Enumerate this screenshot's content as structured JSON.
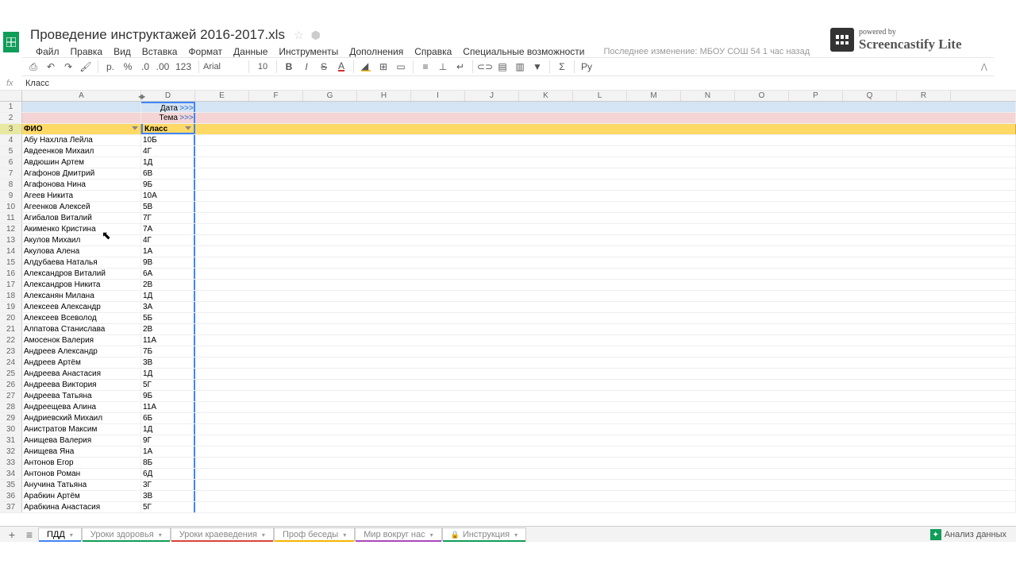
{
  "title": "Проведение инструктажей 2016-2017.xls",
  "menus": [
    "Файл",
    "Правка",
    "Вид",
    "Вставка",
    "Формат",
    "Данные",
    "Инструменты",
    "Дополнения",
    "Справка",
    "Специальные возможности"
  ],
  "last_edit": "Последнее изменение: МБОУ СОШ 54 1 час назад",
  "toolbar": {
    "font": "Arial",
    "size": "10",
    "ruble": "р.",
    "pct": "%",
    "dec0": "0←",
    "dec00": ".00",
    "fmt123": "123"
  },
  "fx_value": "Класс",
  "col_letters": [
    "A",
    "D",
    "E",
    "F",
    "G",
    "H",
    "I",
    "J",
    "K",
    "L",
    "M",
    "N",
    "O",
    "P",
    "Q",
    "R"
  ],
  "row1": {
    "label": "Дата",
    "arrow": ">>>"
  },
  "row2": {
    "label": "Тема",
    "arrow": ">>>"
  },
  "row3": {
    "fio": "ФИО",
    "klass": "Класс"
  },
  "data_rows": [
    {
      "n": 4,
      "a": "Абу Нахлла Лейла",
      "d": "10Б"
    },
    {
      "n": 5,
      "a": "Авдеенков Михаил",
      "d": "4Г"
    },
    {
      "n": 6,
      "a": "Авдюшин Артем",
      "d": "1Д"
    },
    {
      "n": 7,
      "a": "Агафонов Дмитрий",
      "d": "6В"
    },
    {
      "n": 8,
      "a": "Агафонова Нина",
      "d": "9Б"
    },
    {
      "n": 9,
      "a": "Агеев Никита",
      "d": "10А"
    },
    {
      "n": 10,
      "a": "Агеенков Алексей",
      "d": "5В"
    },
    {
      "n": 11,
      "a": "Агибалов Виталий",
      "d": "7Г"
    },
    {
      "n": 12,
      "a": "Акименко Кристина",
      "d": "7А"
    },
    {
      "n": 13,
      "a": "Акулов Михаил",
      "d": "4Г"
    },
    {
      "n": 14,
      "a": "Акулова Алена",
      "d": "1А"
    },
    {
      "n": 15,
      "a": "Алдубаева Наталья",
      "d": "9В"
    },
    {
      "n": 16,
      "a": "Александров Виталий",
      "d": "6А"
    },
    {
      "n": 17,
      "a": "Александров Никита",
      "d": "2В"
    },
    {
      "n": 18,
      "a": "Алексанян Милана",
      "d": "1Д"
    },
    {
      "n": 19,
      "a": "Алексеев Александр",
      "d": "3А"
    },
    {
      "n": 20,
      "a": "Алексеев Всеволод",
      "d": "5Б"
    },
    {
      "n": 21,
      "a": "Алпатова Станислава",
      "d": "2В"
    },
    {
      "n": 22,
      "a": "Амосенок Валерия",
      "d": "11А"
    },
    {
      "n": 23,
      "a": "Андреев Александр",
      "d": "7Б"
    },
    {
      "n": 24,
      "a": "Андреев Артём",
      "d": "3В"
    },
    {
      "n": 25,
      "a": "Андреева Анастасия",
      "d": "1Д"
    },
    {
      "n": 26,
      "a": "Андреева Виктория",
      "d": "5Г"
    },
    {
      "n": 27,
      "a": "Андреева Татьяна",
      "d": "9Б"
    },
    {
      "n": 28,
      "a": "Андреещева Алина",
      "d": "11А"
    },
    {
      "n": 29,
      "a": "Андриевский Михаил",
      "d": "6Б"
    },
    {
      "n": 30,
      "a": "Анистратов Максим",
      "d": "1Д"
    },
    {
      "n": 31,
      "a": "Анищева Валерия",
      "d": "9Г"
    },
    {
      "n": 32,
      "a": "Анищева Яна",
      "d": "1А"
    },
    {
      "n": 33,
      "a": "Антонов Егор",
      "d": "8Б"
    },
    {
      "n": 34,
      "a": "Антонов Роман",
      "d": "6Д"
    },
    {
      "n": 35,
      "a": "Анучина Татьяна",
      "d": "3Г"
    },
    {
      "n": 36,
      "a": "Арабкин Артём",
      "d": "3В"
    },
    {
      "n": 37,
      "a": "Арабкина Анастасия",
      "d": "5Г"
    }
  ],
  "tabs": [
    {
      "name": "ПДД",
      "color": "#4285f4",
      "active": true,
      "lock": false
    },
    {
      "name": "Уроки здоровья",
      "color": "#0f9d58",
      "active": false,
      "lock": false
    },
    {
      "name": "Уроки краеведения",
      "color": "#db4437",
      "active": false,
      "lock": false
    },
    {
      "name": "Проф беседы",
      "color": "#f4b400",
      "active": false,
      "lock": false
    },
    {
      "name": "Мир вокруг нас",
      "color": "#ab47bc",
      "active": false,
      "lock": false
    },
    {
      "name": "Инструкция",
      "color": "#0f9d58",
      "active": false,
      "lock": true
    }
  ],
  "analyze": "Анализ данных",
  "brand_top": "powered by",
  "brand_bot": "Screencastify Lite"
}
